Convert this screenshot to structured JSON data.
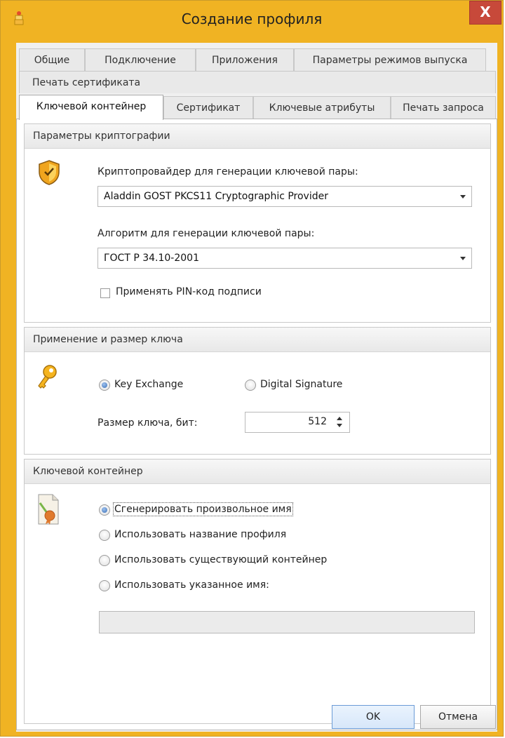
{
  "window": {
    "title": "Создание профиля",
    "close_label": "X"
  },
  "tabs_row1": [
    "Общие",
    "Подключение",
    "Приложения",
    "Параметры режимов выпуска"
  ],
  "tabs_row2": [
    "Печать сертификата"
  ],
  "tabs_row3": [
    "Ключевой контейнер",
    "Сертификат",
    "Ключевые атрибуты",
    "Печать запроса"
  ],
  "active_tab": "Ключевой контейнер",
  "crypto": {
    "header": "Параметры криптографии",
    "provider_label": "Криптопровайдер для генерации ключевой пары:",
    "provider_value": "Aladdin GOST PKCS11 Cryptographic Provider",
    "algorithm_label": "Алгоритм для генерации ключевой пары:",
    "algorithm_value": "ГОСТ Р 34.10-2001",
    "pin_checkbox_label": "Применять PIN-код подписи",
    "pin_checked": false
  },
  "usage": {
    "header": "Применение и размер ключа",
    "key_exchange_label": "Key Exchange",
    "digital_signature_label": "Digital Signature",
    "selected": "Key Exchange",
    "key_size_label": "Размер ключа, бит:",
    "key_size_value": "512"
  },
  "container": {
    "header": "Ключевой контейнер",
    "options": [
      "Сгенерировать произвольное имя",
      "Использовать название профиля",
      "Использовать существующий контейнер",
      "Использовать указанное имя:"
    ],
    "selected_index": 0,
    "name_value": ""
  },
  "buttons": {
    "ok": "OK",
    "cancel": "Отмена"
  },
  "colors": {
    "frame": "#f0b323",
    "close": "#c7493a",
    "radio_selected": "#3a6fb7"
  }
}
